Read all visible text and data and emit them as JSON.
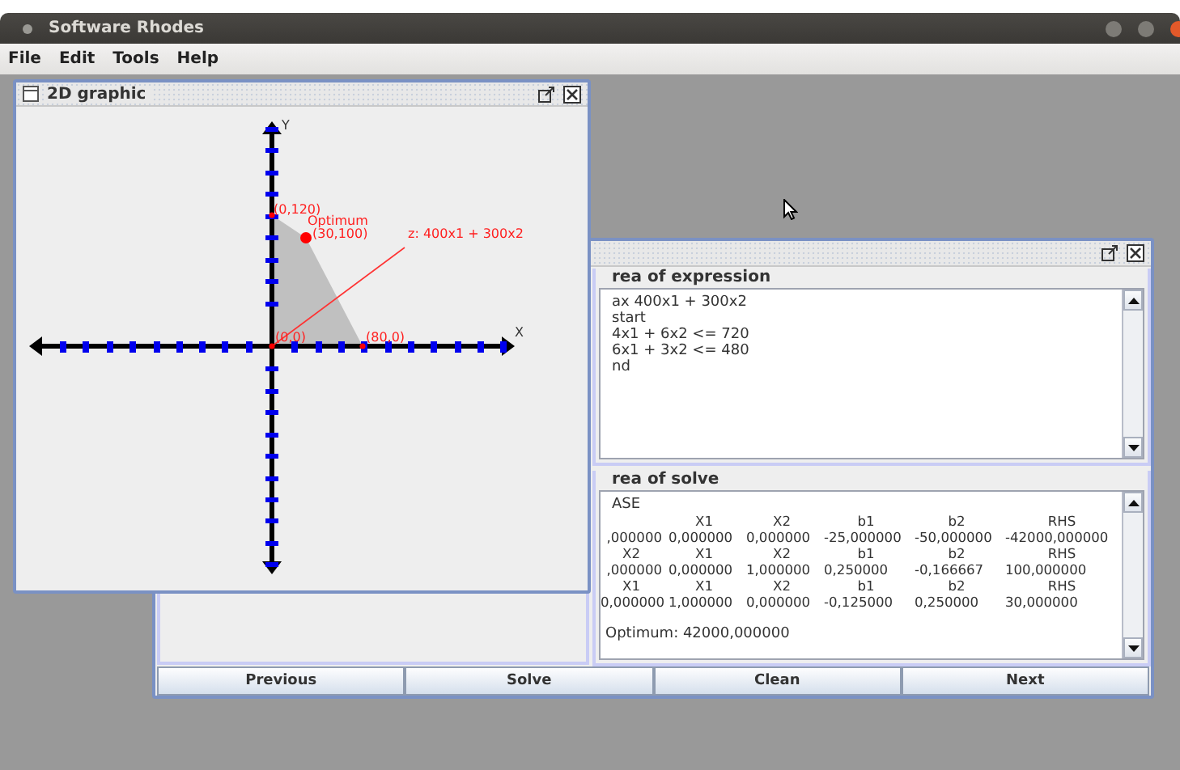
{
  "window": {
    "title": "Software Rhodes"
  },
  "menu": [
    "File",
    "Edit",
    "Tools",
    "Help"
  ],
  "graphic_frame": {
    "title": "2D graphic",
    "axis_labels": [
      "X",
      "Y"
    ],
    "point_labels": [
      "(0,120)",
      "Optimum",
      "(30,100)",
      "z: 400x1 + 300x2",
      "(0,0)",
      "(80,0)"
    ]
  },
  "solver_frame": {
    "expression": {
      "legend": "rea of expression",
      "lines": [
        "ax 400x1 + 300x2",
        "start",
        "4x1 + 6x2 <= 720",
        "6x1 + 3x2 <= 480",
        "nd"
      ]
    },
    "solve": {
      "legend": "rea of solve",
      "lines": [
        {
          "kind": "text",
          "text": "ASE"
        },
        {
          "kind": "header",
          "cells": [
            "X1",
            "X2",
            "b1",
            "b2",
            "RHS"
          ]
        },
        {
          "kind": "row",
          "cells": [
            ",000000",
            "0,000000",
            "0,000000",
            "-25,000000",
            "-50,000000",
            "-42000,000000"
          ]
        },
        {
          "kind": "header",
          "label": "X2",
          "cells": [
            "X1",
            "X2",
            "b1",
            "b2",
            "RHS"
          ]
        },
        {
          "kind": "row",
          "cells": [
            ",000000",
            "0,000000",
            "1,000000",
            "0,250000",
            "-0,166667",
            "100,000000"
          ]
        },
        {
          "kind": "header",
          "label": "X1",
          "cells": [
            "X1",
            "X2",
            "b1",
            "b2",
            "RHS"
          ]
        },
        {
          "kind": "row",
          "cells": [
            "0,000000",
            "1,000000",
            "0,000000",
            "-0,125000",
            "0,250000",
            "30,000000"
          ]
        },
        {
          "kind": "blank"
        },
        {
          "kind": "result",
          "text": "Optimum: 42000,000000"
        }
      ]
    },
    "buttons": [
      "Previous",
      "Solve",
      "Clean",
      "Next"
    ]
  }
}
